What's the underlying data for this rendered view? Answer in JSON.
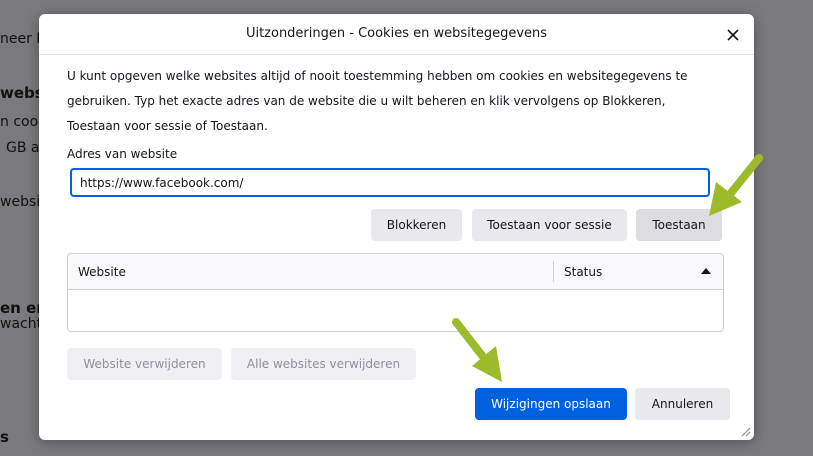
{
  "background": {
    "fragments": [
      "neer Fi",
      "website",
      "n cook",
      "GB aa",
      "websi",
      "en en",
      "wachtw",
      "s"
    ]
  },
  "dialog": {
    "title": "Uitzonderingen - Cookies en websitegegevens",
    "intro": "U kunt opgeven welke websites altijd of nooit toestemming hebben om cookies en websitegegevens te gebruiken. Typ het exacte adres van de website die u wilt beheren en klik vervolgens op Blokkeren, Toestaan voor sessie of Toestaan.",
    "address_label": "Adres van website",
    "address_value": "https://www.facebook.com/",
    "buttons": {
      "block": "Blokkeren",
      "allow_session": "Toestaan voor sessie",
      "allow": "Toestaan",
      "remove_website": "Website verwijderen",
      "remove_all": "Alle websites verwijderen",
      "save": "Wijzigingen opslaan",
      "cancel": "Annuleren"
    },
    "table": {
      "columns": [
        "Website",
        "Status"
      ],
      "rows": []
    }
  },
  "colors": {
    "accent": "#0061e0",
    "arrow": "#9bbb2b",
    "overlay": "#7b7b7e"
  },
  "icons": [
    "close-icon",
    "sort-ascending-icon",
    "resize-grip-icon",
    "annotation-arrow"
  ]
}
